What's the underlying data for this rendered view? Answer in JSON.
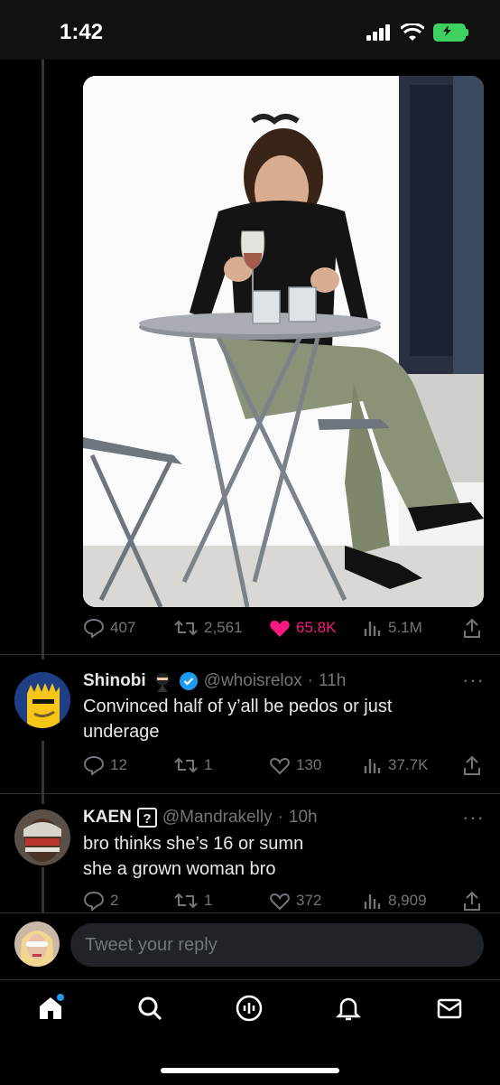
{
  "status": {
    "time": "1:42"
  },
  "main_tweet": {
    "image_alt": "photo",
    "actions": {
      "replies": "407",
      "retweets": "2,561",
      "likes": "65.8K",
      "views": "5.1M"
    },
    "like_color": "#f91880"
  },
  "replies": [
    {
      "name": "Shinobi",
      "badge_emoji": "ninja",
      "verified": true,
      "handle": "@whoisrelox",
      "time": "11h",
      "text_line1": "Convinced half of y’all be pedos or just",
      "text_line2": "underage",
      "actions": {
        "replies": "12",
        "retweets": "1",
        "likes": "130",
        "views": "37.7K"
      }
    },
    {
      "name": "KAEN",
      "badge_emoji": "question-box",
      "verified": false,
      "handle": "@Mandrakelly",
      "time": "10h",
      "text_line1": "bro thinks she’s 16 or sumn",
      "text_line2": "she a grown woman bro",
      "actions": {
        "replies": "2",
        "retweets": "1",
        "likes": "372",
        "views": "8,909"
      }
    }
  ],
  "compose": {
    "placeholder": "Tweet your reply"
  },
  "tabbar": {
    "items": [
      "home-icon",
      "search-icon",
      "spaces-icon",
      "notifications-icon",
      "messages-icon"
    ]
  },
  "colors": {
    "accent": "#1d9bf0",
    "muted": "#71767b",
    "background": "#000000"
  }
}
